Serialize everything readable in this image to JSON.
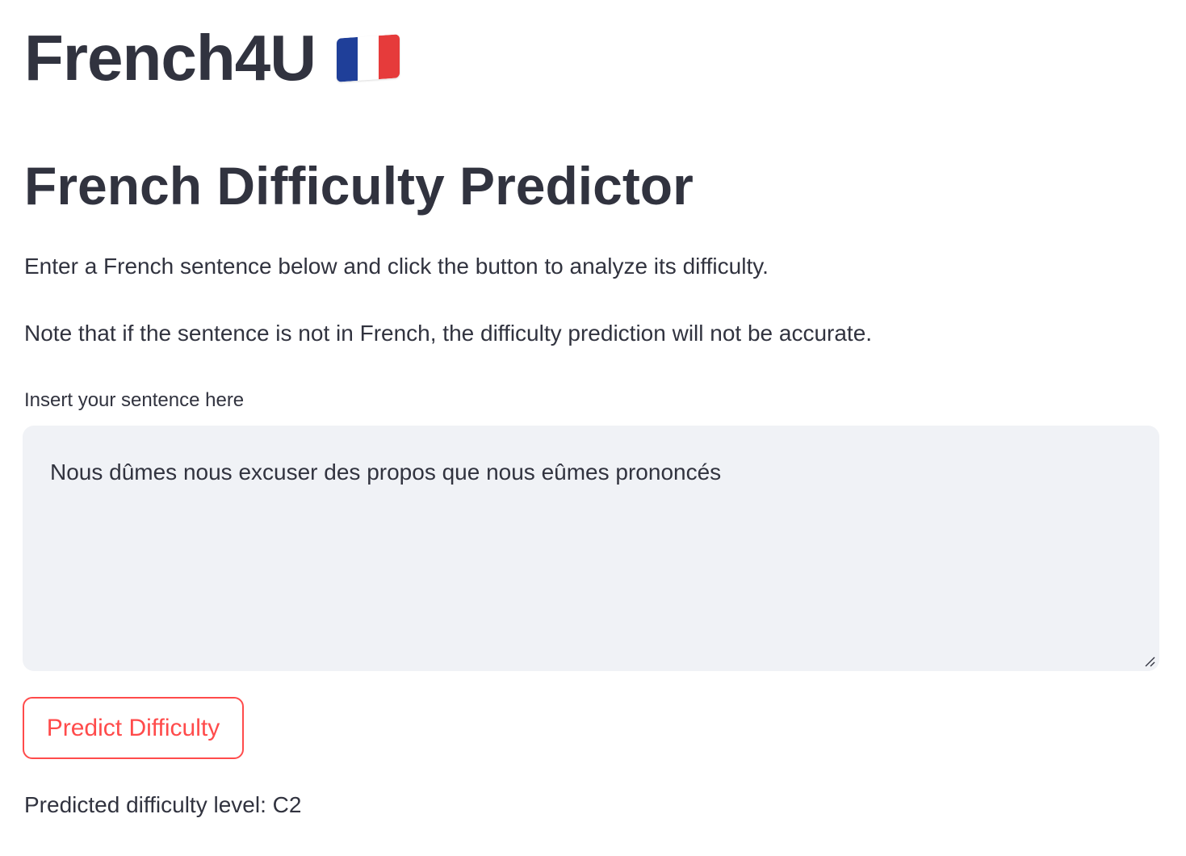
{
  "app": {
    "title": "French4U",
    "flag_icon": "france-flag-icon",
    "flag_colors": [
      "#1f3f99",
      "#ffffff",
      "#e63b3b"
    ]
  },
  "main": {
    "heading": "French Difficulty Predictor",
    "intro": "Enter a French sentence below and click the button to analyze its difficulty.",
    "note": "Note that if the sentence is not in French, the difficulty prediction will not be accurate."
  },
  "sentence_field": {
    "label": "Insert your sentence here",
    "value": "Nous dûmes nous excuser des propos que nous eûmes prononcés"
  },
  "predict_button": {
    "label": "Predict Difficulty",
    "color": "#ff4b4b"
  },
  "result": {
    "text": "Predicted difficulty level: C2"
  }
}
